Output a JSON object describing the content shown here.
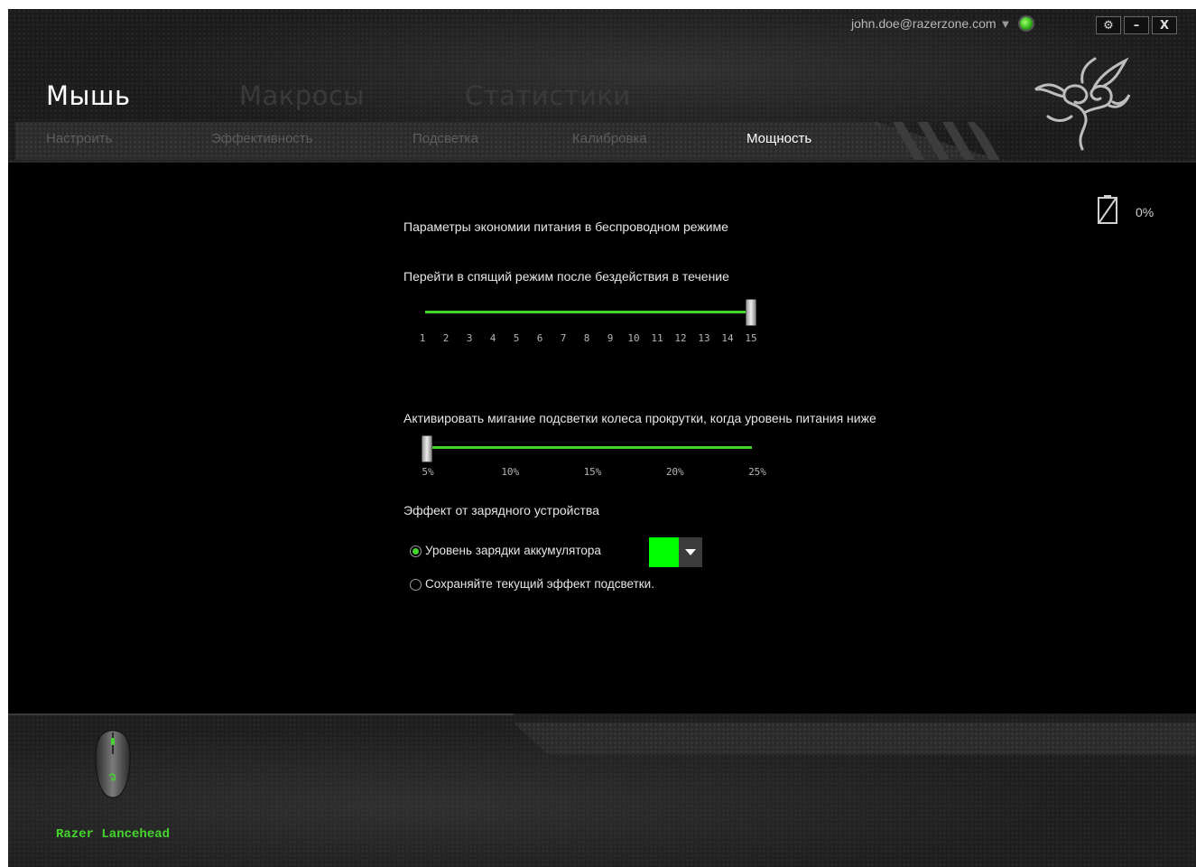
{
  "account": {
    "email": "john.doe@razerzone.com"
  },
  "window_controls": {
    "settings": "⚙",
    "minimize": "–",
    "close": "X"
  },
  "main_tabs": [
    {
      "label": "Мышь",
      "active": true
    },
    {
      "label": "Макросы",
      "active": false
    },
    {
      "label": "Статистики",
      "active": false
    }
  ],
  "sub_tabs": [
    {
      "label": "Настроить",
      "active": false
    },
    {
      "label": "Эффективность",
      "active": false
    },
    {
      "label": "Подсветка",
      "active": false
    },
    {
      "label": "Калибровка",
      "active": false
    },
    {
      "label": "Мощность",
      "active": true
    }
  ],
  "battery": {
    "percent": "0%"
  },
  "power": {
    "section_title": "Параметры экономии питания в беспроводном режиме",
    "sleep": {
      "label": "Перейти в спящий режим после бездействия в течение",
      "ticks": [
        "1",
        "2",
        "3",
        "4",
        "5",
        "6",
        "7",
        "8",
        "9",
        "10",
        "11",
        "12",
        "13",
        "14",
        "15"
      ],
      "value": 15
    },
    "blink": {
      "label": "Активировать мигание подсветки колеса прокрутки, когда уровень питания ниже",
      "ticks": [
        "5%",
        "10%",
        "15%",
        "20%",
        "25%"
      ],
      "value": "5%"
    },
    "charger": {
      "title": "Эффект от зарядного устройства",
      "option_battery": "Уровень зарядки аккумулятора",
      "option_keep": "Сохраняйте текущий эффект подсветки.",
      "selected": "battery",
      "color": "#00ff00"
    }
  },
  "device": {
    "name": "Razer Lancehead"
  },
  "colors": {
    "accent": "#44d62c"
  }
}
